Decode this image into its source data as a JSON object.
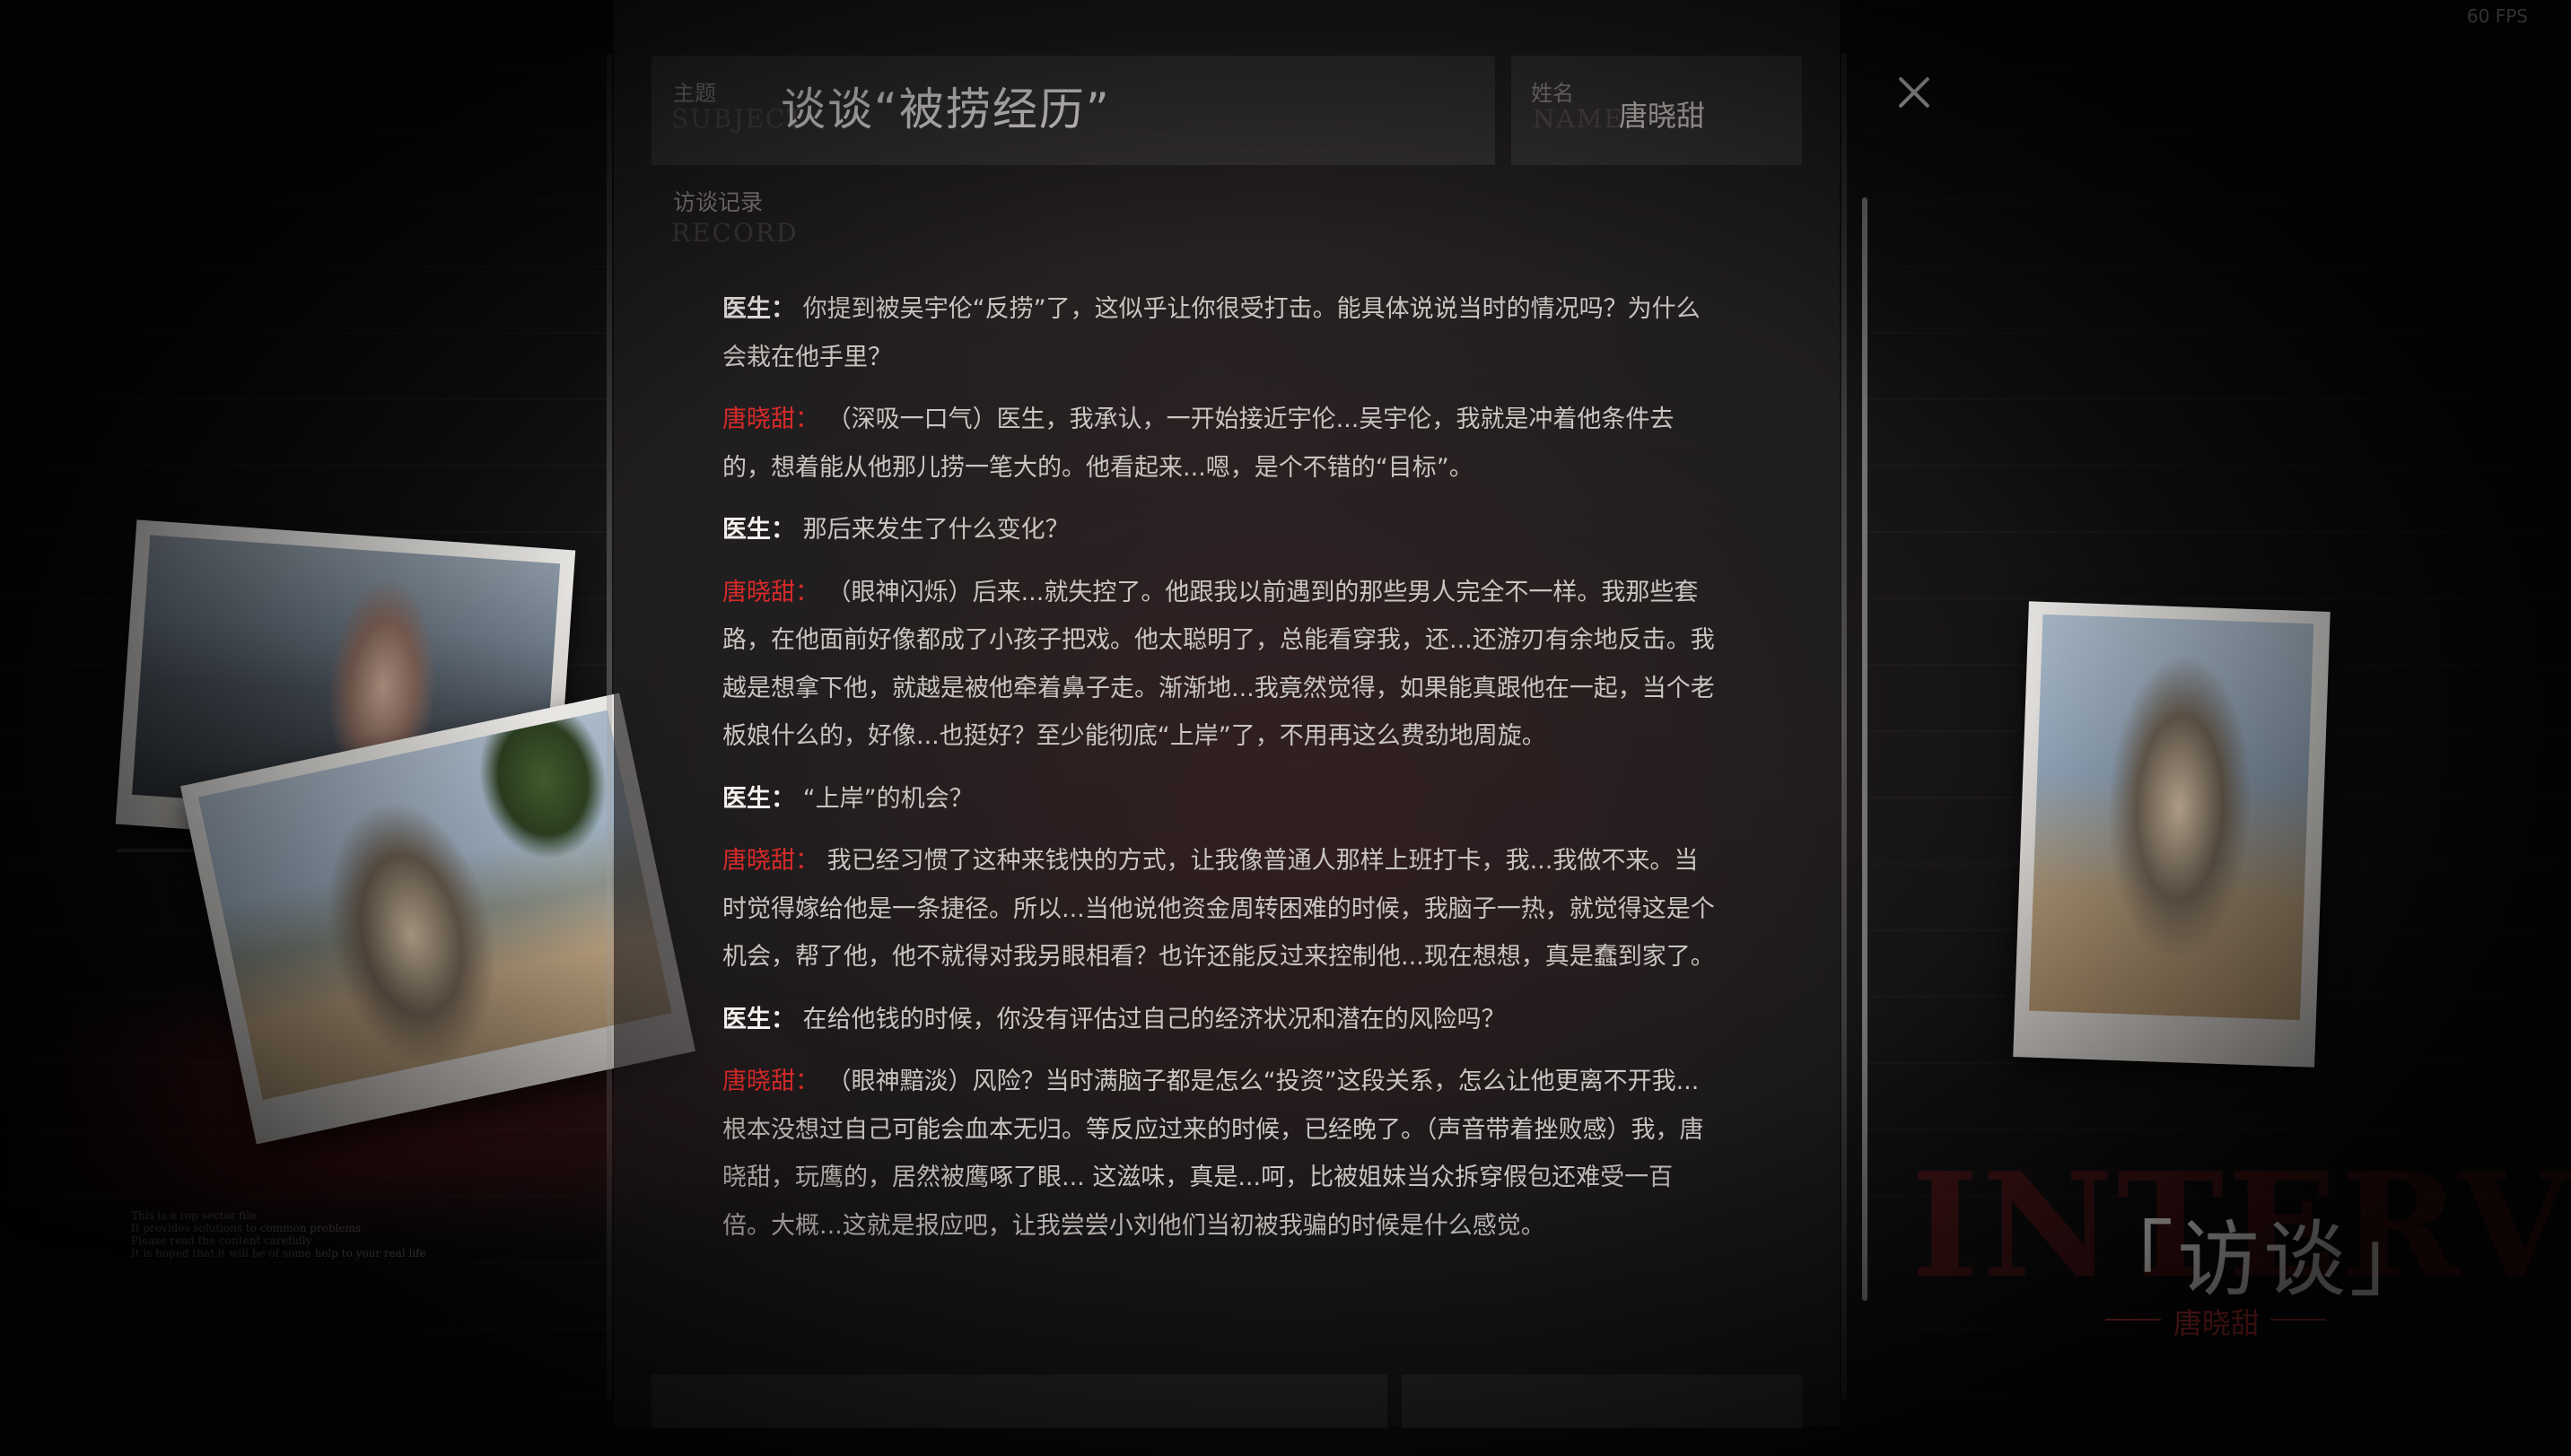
{
  "fps": "60 FPS",
  "header": {
    "subject_label": "主题",
    "subject_label_en": "SUBJECT",
    "subject_title": "谈谈“被捞经历”",
    "name_label": "姓名",
    "name_label_en": "NAME",
    "name_value": "唐晓甜"
  },
  "record": {
    "label": "访谈记录",
    "label_en": "RECORD",
    "entries": [
      {
        "speaker": "医生：",
        "type": "doctor",
        "text": "你提到被吴宇伦“反捞”了，这似乎让你很受打击。能具体说说当时的情况吗？为什么会栽在他手里？"
      },
      {
        "speaker": "唐晓甜：",
        "type": "patient",
        "text": "（深吸一口气）医生，我承认，一开始接近宇伦...吴宇伦，我就是冲着他条件去的，想着能从他那儿捞一笔大的。他看起来...嗯，是个不错的“目标”。"
      },
      {
        "speaker": "医生：",
        "type": "doctor",
        "text": "那后来发生了什么变化？"
      },
      {
        "speaker": "唐晓甜：",
        "type": "patient",
        "text": "（眼神闪烁）后来...就失控了。他跟我以前遇到的那些男人完全不一样。我那些套路，在他面前好像都成了小孩子把戏。他太聪明了，总能看穿我，还...还游刃有余地反击。我越是想拿下他，就越是被他牵着鼻子走。渐渐地...我竟然觉得，如果能真跟他在一起，当个老板娘什么的，好像...也挺好？至少能彻底“上岸”了，不用再这么费劲地周旋。"
      },
      {
        "speaker": "医生：",
        "type": "doctor",
        "text": "“上岸”的机会？"
      },
      {
        "speaker": "唐晓甜：",
        "type": "patient",
        "text": "我已经习惯了这种来钱快的方式，让我像普通人那样上班打卡，我...我做不来。当时觉得嫁给他是一条捷径。所以...当他说他资金周转困难的时候，我脑子一热，就觉得这是个机会，帮了他，他不就得对我另眼相看？也许还能反过来控制他...现在想想，真是蠢到家了。"
      },
      {
        "speaker": "医生：",
        "type": "doctor",
        "text": "在给他钱的时候，你没有评估过自己的经济状况和潜在的风险吗？"
      },
      {
        "speaker": "唐晓甜：",
        "type": "patient",
        "text": "（眼神黯淡）风险？当时满脑子都是怎么“投资”这段关系，怎么让他更离不开我...根本没想过自己可能会血本无归。等反应过来的时候，已经晚了。（声音带着挫败感）我，唐晓甜，玩鹰的，居然被鹰啄了眼... 这滋味，真是...呵，比被姐妹当众拆穿假包还难受一百倍。大概...这就是报应吧，让我尝尝小刘他们当初被我骗的时候是什么感觉。"
      }
    ]
  },
  "notes": {
    "lines": [
      "This is a rop sector file",
      "It provides solutions to common problems",
      "Please read the content carefully",
      "It is hoped that it will be of some help to your real life"
    ]
  },
  "tag": {
    "bg_word": "INTERVIEW",
    "title": "「访谈」",
    "name": "唐晓甜"
  },
  "icons": {
    "close": "close-icon"
  },
  "colors": {
    "accent_red": "#d82a2a",
    "doctor_label": "#f2efec"
  }
}
